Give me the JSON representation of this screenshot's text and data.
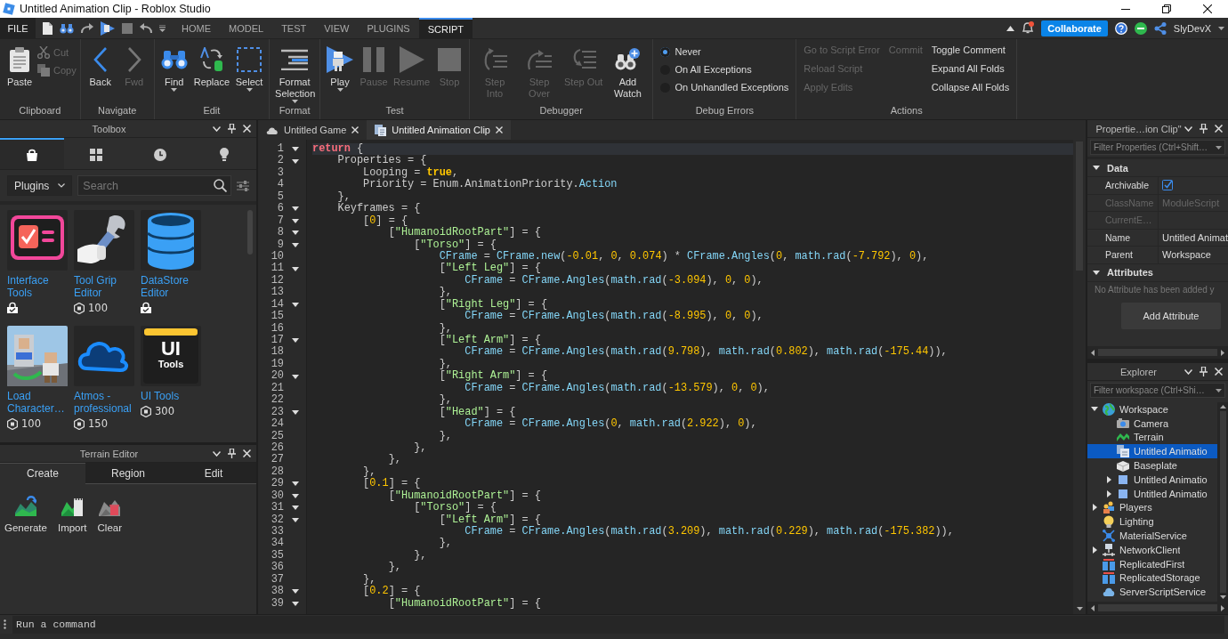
{
  "window": {
    "title": "Untitled Animation Clip - Roblox Studio"
  },
  "menu_bar": {
    "file_menu": "FILE",
    "tabs": [
      {
        "label": "HOME",
        "selected": false
      },
      {
        "label": "MODEL",
        "selected": false
      },
      {
        "label": "TEST",
        "selected": false
      },
      {
        "label": "VIEW",
        "selected": false
      },
      {
        "label": "PLUGINS",
        "selected": false
      },
      {
        "label": "SCRIPT",
        "selected": true
      }
    ],
    "notifications": {
      "unread": true
    },
    "collaborate_button": "Collaborate",
    "user": "SlyDevX"
  },
  "ribbon": {
    "groups": [
      {
        "title": "Clipboard",
        "kind": "buttons",
        "buttons": [
          {
            "label": "Paste",
            "kind": "large",
            "disabled": false,
            "dropdown": false
          },
          {
            "label": "Cut",
            "kind": "small",
            "disabled": true,
            "dropdown": false
          },
          {
            "label": "Copy",
            "kind": "small",
            "disabled": true,
            "dropdown": false
          }
        ]
      },
      {
        "title": "Navigate",
        "kind": "buttons",
        "buttons": [
          {
            "label": "Back",
            "kind": "large",
            "disabled": false,
            "dropdown": false
          },
          {
            "label": "Fwd",
            "kind": "large",
            "disabled": true,
            "dropdown": false
          }
        ]
      },
      {
        "title": "Edit",
        "kind": "buttons",
        "buttons": [
          {
            "label": "Find",
            "kind": "large",
            "disabled": false,
            "dropdown": true
          },
          {
            "label": "Replace",
            "kind": "large",
            "disabled": false,
            "dropdown": false
          },
          {
            "label": "Select",
            "kind": "large",
            "disabled": false,
            "dropdown": true
          }
        ]
      },
      {
        "title": "Format",
        "kind": "buttons",
        "buttons": [
          {
            "label": "Format Selection",
            "kind": "large",
            "disabled": false,
            "dropdown": true
          }
        ]
      },
      {
        "title": "Test",
        "kind": "buttons",
        "buttons": [
          {
            "label": "Play",
            "kind": "large",
            "disabled": false,
            "dropdown": true
          },
          {
            "label": "Pause",
            "kind": "large",
            "disabled": true,
            "dropdown": false
          },
          {
            "label": "Resume",
            "kind": "large",
            "disabled": true,
            "dropdown": false
          },
          {
            "label": "Stop",
            "kind": "large",
            "disabled": true,
            "dropdown": false
          }
        ]
      },
      {
        "title": "Debugger",
        "kind": "buttons",
        "buttons": [
          {
            "label": "Step Into",
            "kind": "large",
            "disabled": true,
            "dropdown": false
          },
          {
            "label": "Step Over",
            "kind": "large",
            "disabled": true,
            "dropdown": false
          },
          {
            "label": "Step Out",
            "kind": "large",
            "disabled": true,
            "dropdown": false
          },
          {
            "label": "Add Watch",
            "kind": "large",
            "disabled": false,
            "dropdown": false
          }
        ]
      },
      {
        "title": "Debug Errors",
        "kind": "radios",
        "options": [
          {
            "label": "Never",
            "selected": true
          },
          {
            "label": "On All Exceptions",
            "selected": false
          },
          {
            "label": "On Unhandled Exceptions",
            "selected": false
          }
        ]
      },
      {
        "title": "Actions",
        "kind": "actions",
        "columns": [
          {
            "items": [
              {
                "label": "Go to Script Error",
                "disabled": true
              },
              {
                "label": "Reload Script",
                "disabled": true
              },
              {
                "label": "Apply Edits",
                "disabled": true
              }
            ]
          },
          {
            "items": [
              {
                "label": "Commit",
                "disabled": true
              }
            ]
          },
          {
            "items": [
              {
                "label": "Toggle Comment",
                "disabled": false
              },
              {
                "label": "Expand All Folds",
                "disabled": false
              },
              {
                "label": "Collapse All Folds",
                "disabled": false
              }
            ]
          }
        ]
      }
    ]
  },
  "toolbox": {
    "title": "Toolbox",
    "tabs": [
      {
        "selected": true
      },
      {
        "selected": false
      },
      {
        "selected": false
      },
      {
        "selected": false
      }
    ],
    "category": "Plugins",
    "search": {
      "placeholder": "Search"
    },
    "items": [
      {
        "name": "Interface Tools",
        "kind": "owned"
      },
      {
        "name": "Tool Grip Editor",
        "kind": "price",
        "price": "100"
      },
      {
        "name": "DataStore Editor",
        "kind": "owned"
      },
      {
        "name": "Load Character…",
        "kind": "price",
        "price": "100"
      },
      {
        "name": "Atmos - professional",
        "kind": "price",
        "price": "150"
      },
      {
        "name": "UI Tools",
        "kind": "price",
        "price": "300",
        "thumbnail_text": [
          "UI",
          "Tools"
        ]
      }
    ]
  },
  "terrain_editor": {
    "title": "Terrain Editor",
    "tabs": [
      {
        "label": "Create",
        "selected": true
      },
      {
        "label": "Region",
        "selected": false
      },
      {
        "label": "Edit",
        "selected": false
      }
    ],
    "tools": [
      "Generate",
      "Import",
      "Clear"
    ]
  },
  "editor": {
    "tabs": [
      {
        "label": "Untitled Game",
        "selected": false
      },
      {
        "label": "Untitled Animation Clip",
        "selected": true
      }
    ],
    "lines": [
      {
        "number": "1",
        "fold": true,
        "current": true,
        "tokens": [
          {
            "kind": "kw",
            "text": "return"
          },
          {
            "kind": "p",
            "text": " {"
          }
        ]
      },
      {
        "number": "2",
        "fold": true,
        "current": false,
        "tokens": [
          {
            "kind": "p",
            "text": "Properties = {"
          }
        ]
      },
      {
        "number": "3",
        "fold": false,
        "current": false,
        "tokens": [
          {
            "kind": "p",
            "text": "Looping = "
          },
          {
            "kind": "bool",
            "text": "true"
          },
          {
            "kind": "p",
            "text": ","
          }
        ]
      },
      {
        "number": "4",
        "fold": false,
        "current": false,
        "tokens": [
          {
            "kind": "p",
            "text": "Priority = Enum.AnimationPriority."
          },
          {
            "kind": "fn",
            "text": "Action"
          }
        ]
      },
      {
        "number": "5",
        "fold": false,
        "current": false,
        "tokens": [
          {
            "kind": "p",
            "text": "},"
          }
        ]
      },
      {
        "number": "6",
        "fold": true,
        "current": false,
        "tokens": [
          {
            "kind": "p",
            "text": "Keyframes = {"
          }
        ]
      },
      {
        "number": "7",
        "fold": true,
        "current": false,
        "tokens": [
          {
            "kind": "p",
            "text": "["
          },
          {
            "kind": "num",
            "text": "0"
          },
          {
            "kind": "p",
            "text": "] = {"
          }
        ]
      },
      {
        "number": "8",
        "fold": true,
        "current": false,
        "tokens": [
          {
            "kind": "p",
            "text": "["
          },
          {
            "kind": "str",
            "text": "\"HumanoidRootPart\""
          },
          {
            "kind": "p",
            "text": "] = {"
          }
        ]
      },
      {
        "number": "9",
        "fold": true,
        "current": false,
        "tokens": [
          {
            "kind": "p",
            "text": "["
          },
          {
            "kind": "str",
            "text": "\"Torso\""
          },
          {
            "kind": "p",
            "text": "] = {"
          }
        ]
      },
      {
        "number": "10",
        "fold": false,
        "current": false,
        "tokens": [
          {
            "kind": "fn",
            "text": "CFrame"
          },
          {
            "kind": "p",
            "text": " = "
          },
          {
            "kind": "fn",
            "text": "CFrame.new"
          },
          {
            "kind": "p",
            "text": "("
          },
          {
            "kind": "num",
            "text": "-0.01"
          },
          {
            "kind": "p",
            "text": ", "
          },
          {
            "kind": "num",
            "text": "0"
          },
          {
            "kind": "p",
            "text": ", "
          },
          {
            "kind": "num",
            "text": "0.074"
          },
          {
            "kind": "p",
            "text": ") * "
          },
          {
            "kind": "fn",
            "text": "CFrame.Angles"
          },
          {
            "kind": "p",
            "text": "("
          },
          {
            "kind": "num",
            "text": "0"
          },
          {
            "kind": "p",
            "text": ", "
          },
          {
            "kind": "fn",
            "text": "math.rad"
          },
          {
            "kind": "p",
            "text": "("
          },
          {
            "kind": "num",
            "text": "-7.792"
          },
          {
            "kind": "p",
            "text": "), "
          },
          {
            "kind": "num",
            "text": "0"
          },
          {
            "kind": "p",
            "text": "),"
          }
        ]
      },
      {
        "number": "11",
        "fold": true,
        "current": false,
        "tokens": [
          {
            "kind": "p",
            "text": "["
          },
          {
            "kind": "str",
            "text": "\"Left Leg\""
          },
          {
            "kind": "p",
            "text": "] = {"
          }
        ]
      },
      {
        "number": "12",
        "fold": false,
        "current": false,
        "tokens": [
          {
            "kind": "fn",
            "text": "CFrame"
          },
          {
            "kind": "p",
            "text": " = "
          },
          {
            "kind": "fn",
            "text": "CFrame.Angles"
          },
          {
            "kind": "p",
            "text": "("
          },
          {
            "kind": "fn",
            "text": "math.rad"
          },
          {
            "kind": "p",
            "text": "("
          },
          {
            "kind": "num",
            "text": "-3.094"
          },
          {
            "kind": "p",
            "text": "), "
          },
          {
            "kind": "num",
            "text": "0"
          },
          {
            "kind": "p",
            "text": ", "
          },
          {
            "kind": "num",
            "text": "0"
          },
          {
            "kind": "p",
            "text": "),"
          }
        ]
      },
      {
        "number": "13",
        "fold": false,
        "current": false,
        "tokens": [
          {
            "kind": "p",
            "text": "},"
          }
        ]
      },
      {
        "number": "14",
        "fold": true,
        "current": false,
        "tokens": [
          {
            "kind": "p",
            "text": "["
          },
          {
            "kind": "str",
            "text": "\"Right Leg\""
          },
          {
            "kind": "p",
            "text": "] = {"
          }
        ]
      },
      {
        "number": "15",
        "fold": false,
        "current": false,
        "tokens": [
          {
            "kind": "fn",
            "text": "CFrame"
          },
          {
            "kind": "p",
            "text": " = "
          },
          {
            "kind": "fn",
            "text": "CFrame.Angles"
          },
          {
            "kind": "p",
            "text": "("
          },
          {
            "kind": "fn",
            "text": "math.rad"
          },
          {
            "kind": "p",
            "text": "("
          },
          {
            "kind": "num",
            "text": "-8.995"
          },
          {
            "kind": "p",
            "text": "), "
          },
          {
            "kind": "num",
            "text": "0"
          },
          {
            "kind": "p",
            "text": ", "
          },
          {
            "kind": "num",
            "text": "0"
          },
          {
            "kind": "p",
            "text": "),"
          }
        ]
      },
      {
        "number": "16",
        "fold": false,
        "current": false,
        "tokens": [
          {
            "kind": "p",
            "text": "},"
          }
        ]
      },
      {
        "number": "17",
        "fold": true,
        "current": false,
        "tokens": [
          {
            "kind": "p",
            "text": "["
          },
          {
            "kind": "str",
            "text": "\"Left Arm\""
          },
          {
            "kind": "p",
            "text": "] = {"
          }
        ]
      },
      {
        "number": "18",
        "fold": false,
        "current": false,
        "tokens": [
          {
            "kind": "fn",
            "text": "CFrame"
          },
          {
            "kind": "p",
            "text": " = "
          },
          {
            "kind": "fn",
            "text": "CFrame.Angles"
          },
          {
            "kind": "p",
            "text": "("
          },
          {
            "kind": "fn",
            "text": "math.rad"
          },
          {
            "kind": "p",
            "text": "("
          },
          {
            "kind": "num",
            "text": "9.798"
          },
          {
            "kind": "p",
            "text": "), "
          },
          {
            "kind": "fn",
            "text": "math.rad"
          },
          {
            "kind": "p",
            "text": "("
          },
          {
            "kind": "num",
            "text": "0.802"
          },
          {
            "kind": "p",
            "text": "), "
          },
          {
            "kind": "fn",
            "text": "math.rad"
          },
          {
            "kind": "p",
            "text": "("
          },
          {
            "kind": "num",
            "text": "-175.44"
          },
          {
            "kind": "p",
            "text": ")),"
          }
        ]
      },
      {
        "number": "19",
        "fold": false,
        "current": false,
        "tokens": [
          {
            "kind": "p",
            "text": "},"
          }
        ]
      },
      {
        "number": "20",
        "fold": true,
        "current": false,
        "tokens": [
          {
            "kind": "p",
            "text": "["
          },
          {
            "kind": "str",
            "text": "\"Right Arm\""
          },
          {
            "kind": "p",
            "text": "] = {"
          }
        ]
      },
      {
        "number": "21",
        "fold": false,
        "current": false,
        "tokens": [
          {
            "kind": "fn",
            "text": "CFrame"
          },
          {
            "kind": "p",
            "text": " = "
          },
          {
            "kind": "fn",
            "text": "CFrame.Angles"
          },
          {
            "kind": "p",
            "text": "("
          },
          {
            "kind": "fn",
            "text": "math.rad"
          },
          {
            "kind": "p",
            "text": "("
          },
          {
            "kind": "num",
            "text": "-13.579"
          },
          {
            "kind": "p",
            "text": "), "
          },
          {
            "kind": "num",
            "text": "0"
          },
          {
            "kind": "p",
            "text": ", "
          },
          {
            "kind": "num",
            "text": "0"
          },
          {
            "kind": "p",
            "text": "),"
          }
        ]
      },
      {
        "number": "22",
        "fold": false,
        "current": false,
        "tokens": [
          {
            "kind": "p",
            "text": "},"
          }
        ]
      },
      {
        "number": "23",
        "fold": true,
        "current": false,
        "tokens": [
          {
            "kind": "p",
            "text": "["
          },
          {
            "kind": "str",
            "text": "\"Head\""
          },
          {
            "kind": "p",
            "text": "] = {"
          }
        ]
      },
      {
        "number": "24",
        "fold": false,
        "current": false,
        "tokens": [
          {
            "kind": "fn",
            "text": "CFrame"
          },
          {
            "kind": "p",
            "text": " = "
          },
          {
            "kind": "fn",
            "text": "CFrame.Angles"
          },
          {
            "kind": "p",
            "text": "("
          },
          {
            "kind": "num",
            "text": "0"
          },
          {
            "kind": "p",
            "text": ", "
          },
          {
            "kind": "fn",
            "text": "math.rad"
          },
          {
            "kind": "p",
            "text": "("
          },
          {
            "kind": "num",
            "text": "2.922"
          },
          {
            "kind": "p",
            "text": "), "
          },
          {
            "kind": "num",
            "text": "0"
          },
          {
            "kind": "p",
            "text": "),"
          }
        ]
      },
      {
        "number": "25",
        "fold": false,
        "current": false,
        "tokens": [
          {
            "kind": "p",
            "text": "},"
          }
        ]
      },
      {
        "number": "26",
        "fold": false,
        "current": false,
        "tokens": [
          {
            "kind": "p",
            "text": "},"
          }
        ]
      },
      {
        "number": "27",
        "fold": false,
        "current": false,
        "tokens": [
          {
            "kind": "p",
            "text": "},"
          }
        ]
      },
      {
        "number": "28",
        "fold": false,
        "current": false,
        "tokens": [
          {
            "kind": "p",
            "text": "},"
          }
        ]
      },
      {
        "number": "29",
        "fold": true,
        "current": false,
        "tokens": [
          {
            "kind": "p",
            "text": "["
          },
          {
            "kind": "num",
            "text": "0.1"
          },
          {
            "kind": "p",
            "text": "] = {"
          }
        ]
      },
      {
        "number": "30",
        "fold": true,
        "current": false,
        "tokens": [
          {
            "kind": "p",
            "text": "["
          },
          {
            "kind": "str",
            "text": "\"HumanoidRootPart\""
          },
          {
            "kind": "p",
            "text": "] = {"
          }
        ]
      },
      {
        "number": "31",
        "fold": true,
        "current": false,
        "tokens": [
          {
            "kind": "p",
            "text": "["
          },
          {
            "kind": "str",
            "text": "\"Torso\""
          },
          {
            "kind": "p",
            "text": "] = {"
          }
        ]
      },
      {
        "number": "32",
        "fold": true,
        "current": false,
        "tokens": [
          {
            "kind": "p",
            "text": "["
          },
          {
            "kind": "str",
            "text": "\"Left Arm\""
          },
          {
            "kind": "p",
            "text": "] = {"
          }
        ]
      },
      {
        "number": "33",
        "fold": false,
        "current": false,
        "tokens": [
          {
            "kind": "fn",
            "text": "CFrame"
          },
          {
            "kind": "p",
            "text": " = "
          },
          {
            "kind": "fn",
            "text": "CFrame.Angles"
          },
          {
            "kind": "p",
            "text": "("
          },
          {
            "kind": "fn",
            "text": "math.rad"
          },
          {
            "kind": "p",
            "text": "("
          },
          {
            "kind": "num",
            "text": "3.209"
          },
          {
            "kind": "p",
            "text": "), "
          },
          {
            "kind": "fn",
            "text": "math.rad"
          },
          {
            "kind": "p",
            "text": "("
          },
          {
            "kind": "num",
            "text": "0.229"
          },
          {
            "kind": "p",
            "text": "), "
          },
          {
            "kind": "fn",
            "text": "math.rad"
          },
          {
            "kind": "p",
            "text": "("
          },
          {
            "kind": "num",
            "text": "-175.382"
          },
          {
            "kind": "p",
            "text": ")),"
          }
        ]
      },
      {
        "number": "34",
        "fold": false,
        "current": false,
        "tokens": [
          {
            "kind": "p",
            "text": "},"
          }
        ]
      },
      {
        "number": "35",
        "fold": false,
        "current": false,
        "tokens": [
          {
            "kind": "p",
            "text": "},"
          }
        ]
      },
      {
        "number": "36",
        "fold": false,
        "current": false,
        "tokens": [
          {
            "kind": "p",
            "text": "},"
          }
        ]
      },
      {
        "number": "37",
        "fold": false,
        "current": false,
        "tokens": [
          {
            "kind": "p",
            "text": "},"
          }
        ]
      },
      {
        "number": "38",
        "fold": true,
        "current": false,
        "tokens": [
          {
            "kind": "p",
            "text": "["
          },
          {
            "kind": "num",
            "text": "0.2"
          },
          {
            "kind": "p",
            "text": "] = {"
          }
        ]
      },
      {
        "number": "39",
        "fold": true,
        "current": false,
        "tokens": [
          {
            "kind": "p",
            "text": "["
          },
          {
            "kind": "str",
            "text": "\"HumanoidRootPart\""
          },
          {
            "kind": "p",
            "text": "] = {"
          }
        ]
      }
    ]
  },
  "properties": {
    "title": "Propertie…ion Clip\"",
    "filter": {
      "placeholder": "Filter Properties (Ctrl+Shift…"
    },
    "sections": [
      {
        "title": "Data",
        "expanded": true,
        "rows": [
          {
            "name": "Archivable",
            "kind": "checkbox",
            "checked": true,
            "disabled": false
          },
          {
            "name": "ClassName",
            "kind": "text",
            "value": "ModuleScript",
            "disabled": true
          },
          {
            "name": "CurrentE…",
            "kind": "text",
            "disabled": true
          },
          {
            "name": "Name",
            "kind": "text",
            "value": "Untitled Animat",
            "disabled": false
          },
          {
            "name": "Parent",
            "kind": "text",
            "value": "Workspace",
            "disabled": false
          }
        ]
      },
      {
        "title": "Attributes",
        "expanded": true,
        "empty_text": "No Attribute has been added y",
        "button": "Add Attribute"
      }
    ]
  },
  "explorer": {
    "title": "Explorer",
    "filter": {
      "placeholder": "Filter workspace (Ctrl+Shi…"
    },
    "tree": [
      {
        "label": "Workspace",
        "kind": "expandable",
        "expanded": true,
        "selected": false,
        "children": [
          {
            "label": "Camera",
            "kind": "leaf",
            "selected": false
          },
          {
            "label": "Terrain",
            "kind": "leaf",
            "selected": false
          },
          {
            "label": "Untitled Animatio",
            "kind": "leaf",
            "selected": true
          },
          {
            "label": "Baseplate",
            "kind": "leaf",
            "selected": false
          },
          {
            "label": "Untitled Animatio",
            "kind": "expandable",
            "expanded": false,
            "selected": false
          },
          {
            "label": "Untitled Animatio",
            "kind": "expandable",
            "expanded": false,
            "selected": false
          }
        ]
      },
      {
        "label": "Players",
        "kind": "expandable",
        "expanded": false,
        "selected": false
      },
      {
        "label": "Lighting",
        "kind": "leaf",
        "selected": false
      },
      {
        "label": "MaterialService",
        "kind": "leaf",
        "selected": false
      },
      {
        "label": "NetworkClient",
        "kind": "expandable",
        "expanded": false,
        "selected": false
      },
      {
        "label": "ReplicatedFirst",
        "kind": "leaf",
        "selected": false
      },
      {
        "label": "ReplicatedStorage",
        "kind": "leaf",
        "selected": false
      },
      {
        "label": "ServerScriptService",
        "kind": "leaf",
        "selected": false
      }
    ]
  },
  "command_bar": {
    "placeholder": "Run a command"
  }
}
